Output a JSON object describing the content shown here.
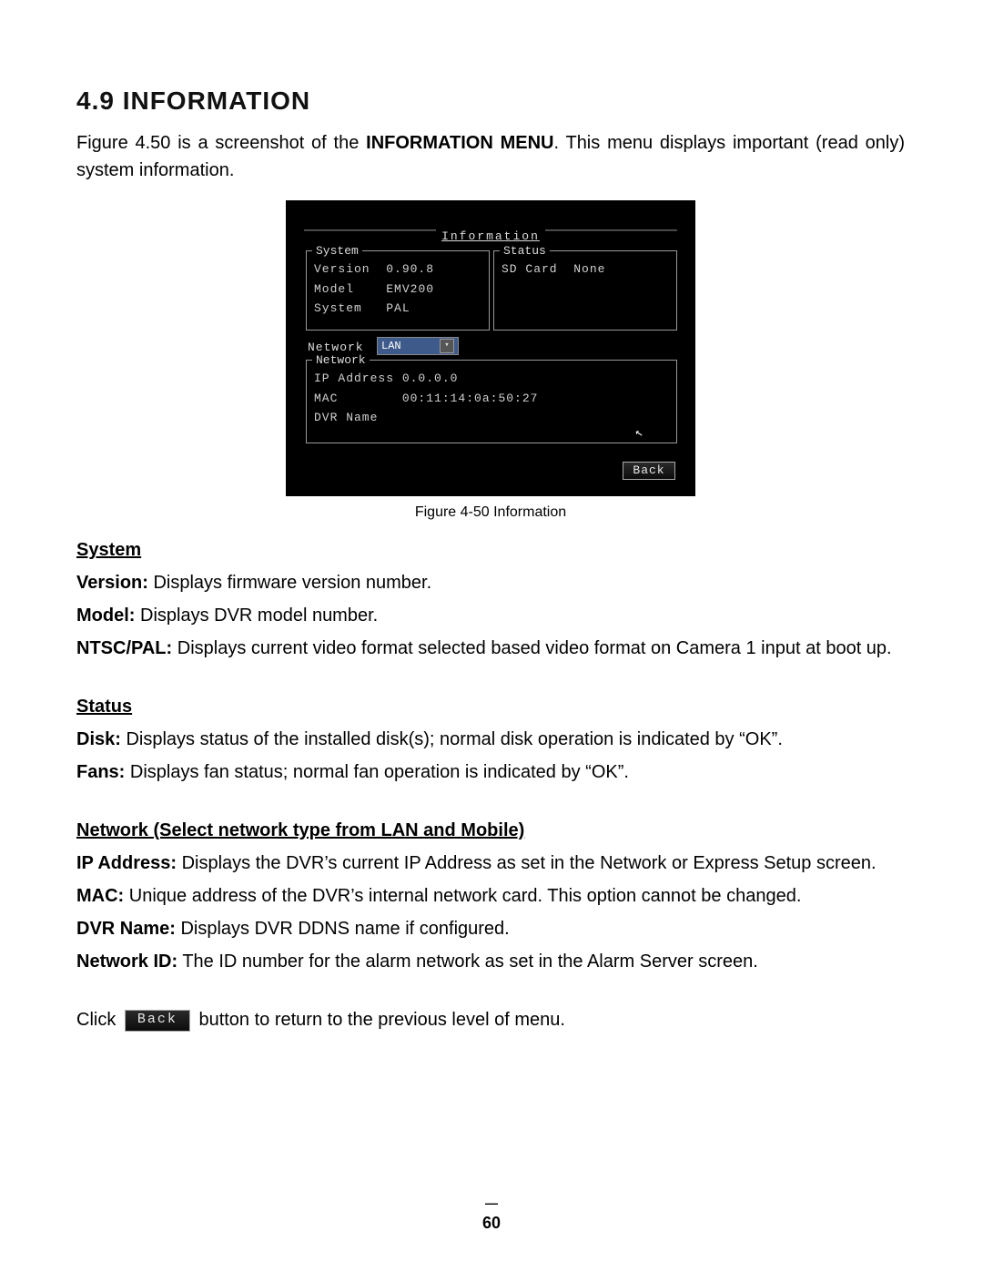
{
  "heading": "4.9 INFORMATION",
  "intro_pre": "Figure 4.50 is a screenshot of the ",
  "intro_bold": "INFORMATION MENU",
  "intro_post": ". This menu displays important (read only) system information.",
  "caption": "Figure 4-50 Information",
  "screenshot": {
    "title": "Information",
    "system": {
      "legend": "System",
      "version_label": "Version",
      "version_value": "0.90.8",
      "model_label": "Model",
      "model_value": "EMV200",
      "system_label": "System",
      "system_value": "PAL"
    },
    "status": {
      "legend": "Status",
      "sd_label": "SD Card",
      "sd_value": "None"
    },
    "network_select_label": "Network",
    "network_select_value": "LAN",
    "network": {
      "legend": "Network",
      "ip_label": "IP Address",
      "ip_value": "0.0.0.0",
      "mac_label": "MAC",
      "mac_value": "00:11:14:0a:50:27",
      "dvr_label": "DVR Name",
      "dvr_value": ""
    },
    "back_label": "Back"
  },
  "sec_system": "System",
  "system_items": {
    "version_l": "Version:",
    "version_t": " Displays firmware version number.",
    "model_l": "Model:",
    "model_t": " Displays DVR model number.",
    "ntsc_l": "NTSC/PAL:",
    "ntsc_t": " Displays current video format selected based video format on Camera 1 input at boot up."
  },
  "sec_status": "Status",
  "status_items": {
    "disk_l": "Disk:",
    "disk_t": " Displays status of the installed disk(s); normal disk operation is indicated by “OK”.",
    "fans_l": "Fans:",
    "fans_t": " Displays fan status; normal fan operation is indicated by “OK”."
  },
  "sec_network": "Network (Select network type from LAN and Mobile)",
  "network_items": {
    "ip_l": "IP Address:",
    "ip_t": " Displays the DVR’s current IP Address as set in the Network or Express Setup screen.",
    "mac_l": "MAC:",
    "mac_t": " Unique address of the DVR’s internal network card. This option cannot be changed.",
    "dvr_l": "DVR Name:",
    "dvr_t": " Displays DVR DDNS name if configured.",
    "nid_l": "Network ID:",
    "nid_t": " The ID number for the alarm network as set in the Alarm Server screen."
  },
  "click_pre": "Click ",
  "click_back": "Back",
  "click_post": " button to return to the previous level of menu.",
  "page_number": "60"
}
